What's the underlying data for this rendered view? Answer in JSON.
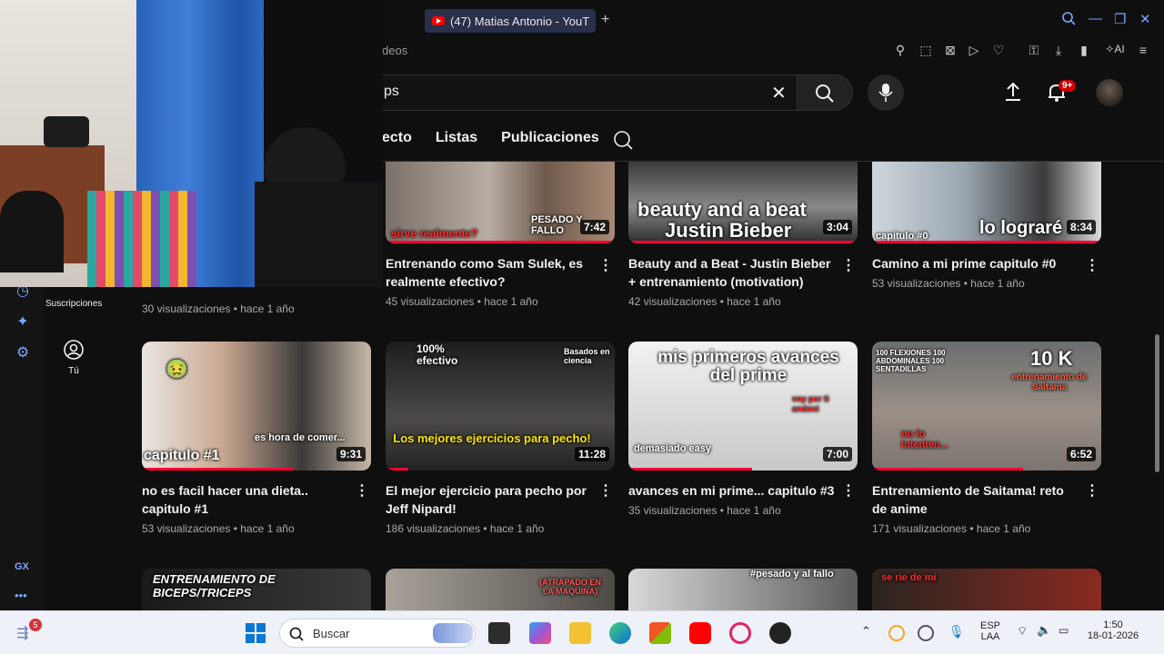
{
  "browser": {
    "tab_title": "(47) Matias Antonio - YouT",
    "url_partial": "deos"
  },
  "search": {
    "query": "ps"
  },
  "notifications": {
    "badge": "9+"
  },
  "channel_tabs": [
    "ecto",
    "Listas",
    "Publicaciones"
  ],
  "sidebar": {
    "subscriptions_label": "Suscripciones",
    "you_label": "Tú",
    "gx_label": "GX"
  },
  "row0": [
    {
      "title": "",
      "meta": "30 visualizaciones • hace 1 año"
    },
    {
      "title": "Entrenando como Sam Sulek, es realmente efectivo?",
      "meta": "45 visualizaciones • hace 1 año",
      "duration": "7:42",
      "thumb_text": "PESADO Y FALLO",
      "thumb_text2": "sirve realmente?"
    },
    {
      "title": "Beauty and a Beat - Justin Bieber + entrenamiento (motivation)",
      "meta": "42 visualizaciones • hace 1 año",
      "duration": "3:04",
      "thumb_text": "beauty and a beat",
      "thumb_text2": "Justin Bieber"
    },
    {
      "title": "Camino a mi prime capitulo #0",
      "meta": "53 visualizaciones • hace 1 año",
      "duration": "8:34",
      "thumb_text": "lo lograré",
      "thumb_text2": "capitulo #0"
    }
  ],
  "row1": [
    {
      "title": "no es facil hacer una dieta.. capitulo #1",
      "meta": "53 visualizaciones • hace 1 año",
      "duration": "9:31",
      "thumb_text": "capitulo #1",
      "thumb_text2": "es hora de comer..."
    },
    {
      "title": "El mejor ejercicio para pecho por Jeff Nipard!",
      "meta": "186 visualizaciones • hace 1 año",
      "duration": "11:28",
      "thumb_text": "Los mejores ejercicios para pecho!",
      "thumb_text2": "100% efectivo",
      "thumb_text3": "Basados en ciencia"
    },
    {
      "title": "avances en mi prime... capitulo #3",
      "meta": "35 visualizaciones • hace 1 año",
      "duration": "7:00",
      "thumb_text": "mis primeros avances del prime",
      "thumb_text2": "demasiado easy",
      "thumb_text3": "voy por ti andoni"
    },
    {
      "title": "Entrenamiento de Saitama! reto de anime",
      "meta": "171 visualizaciones • hace 1 año",
      "duration": "6:52",
      "thumb_text": "10 K",
      "thumb_text2": "entrenamiento de Saitama",
      "thumb_text3": "100 FLEXIONES 100 ABDOMINALES 100 SENTADILLAS",
      "thumb_text4": "no lo intenten..."
    }
  ],
  "row2": [
    {
      "thumb_text": "ENTRENAMIENTO DE BICEPS/TRICEPS"
    },
    {
      "thumb_text": "(ATRAPADO EN LA MAQUINA)"
    },
    {
      "thumb_text": "#pesado y al fallo"
    },
    {
      "thumb_text": "se rie de mi"
    }
  ],
  "taskbar": {
    "search_placeholder": "Buscar",
    "notif_count": "5",
    "lang": "ESP",
    "lang2": "LAA",
    "time": "1:50",
    "date": "18-01-2026"
  },
  "colors": {
    "accent": "#ff0033",
    "gx": "#7aa7ff",
    "background": "#0f0f0f"
  }
}
